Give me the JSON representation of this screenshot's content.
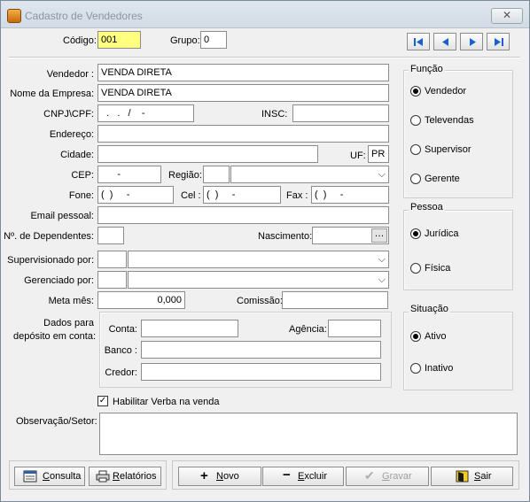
{
  "window": {
    "title": "Cadastro de Vendedores",
    "close_icon": "close-icon"
  },
  "header": {
    "codigo_label": "Código:",
    "codigo_value": "001",
    "grupo_label": "Grupo:",
    "grupo_value": "0",
    "nav": [
      "first-record-icon",
      "previous-record-icon",
      "next-record-icon",
      "last-record-icon"
    ]
  },
  "form": {
    "vendedor_label": "Vendedor :",
    "vendedor_value": "VENDA DIRETA",
    "empresa_label": "Nome da Empresa:",
    "empresa_value": "VENDA DIRETA",
    "cnpj_label": "CNPJ\\CPF:",
    "cnpj_value": "  .   .   /    -",
    "insc_label": "INSC:",
    "insc_value": "",
    "endereco_label": "Endereço:",
    "endereco_value": "",
    "cidade_label": "Cidade:",
    "cidade_value": "",
    "uf_label": "UF:",
    "uf_value": "PR",
    "cep_label": "CEP:",
    "cep_value": "      -",
    "regiao_label": "Região:",
    "regiao_code": "",
    "regiao_value": "",
    "fone_label": "Fone:",
    "fone_value": "(  )     -",
    "cel_label": "Cel :",
    "cel_value": "(  )     -",
    "fax_label": "Fax :",
    "fax_value": "(  )     -",
    "email_label": "Email pessoal:",
    "email_value": "",
    "dependentes_label": "Nº. de Dependentes:",
    "dependentes_value": "",
    "nascimento_label": "Nascimento:",
    "nascimento_value": "  /  /",
    "supervisionado_label": "Supervisionado por:",
    "supervisionado_code": "",
    "supervisionado_value": "",
    "gerenciado_label": "Gerenciado por:",
    "gerenciado_code": "",
    "gerenciado_value": "",
    "meta_label": "Meta mês:",
    "meta_value": "0,000",
    "comissao_label": "Comissão:",
    "comissao_value": "",
    "deposito_label_1": "Dados para",
    "deposito_label_2": "depósito em conta:",
    "conta_label": "Conta:",
    "conta_value": "",
    "agencia_label": "Agência:",
    "agencia_value": "",
    "banco_label": "Banco :",
    "banco_value": "",
    "credor_label": "Credor:",
    "credor_value": "",
    "verba_label": "Habilitar Verba na venda",
    "verba_checked": true,
    "obs_label": "Observação/Setor:",
    "obs_value": ""
  },
  "funcao": {
    "title": "Função",
    "options": [
      "Vendedor",
      "Televendas",
      "Supervisor",
      "Gerente"
    ],
    "selected": "Vendedor"
  },
  "pessoa": {
    "title": "Pessoa",
    "options": [
      "Jurídica",
      "Física"
    ],
    "selected": "Jurídica"
  },
  "situacao": {
    "title": "Situação",
    "options": [
      "Ativo",
      "Inativo"
    ],
    "selected": "Ativo"
  },
  "buttons": {
    "consulta": "Consulta",
    "relatorios": "Relatórios",
    "novo": "Novo",
    "excluir": "Excluir",
    "gravar": "Gravar",
    "sair": "Sair"
  }
}
